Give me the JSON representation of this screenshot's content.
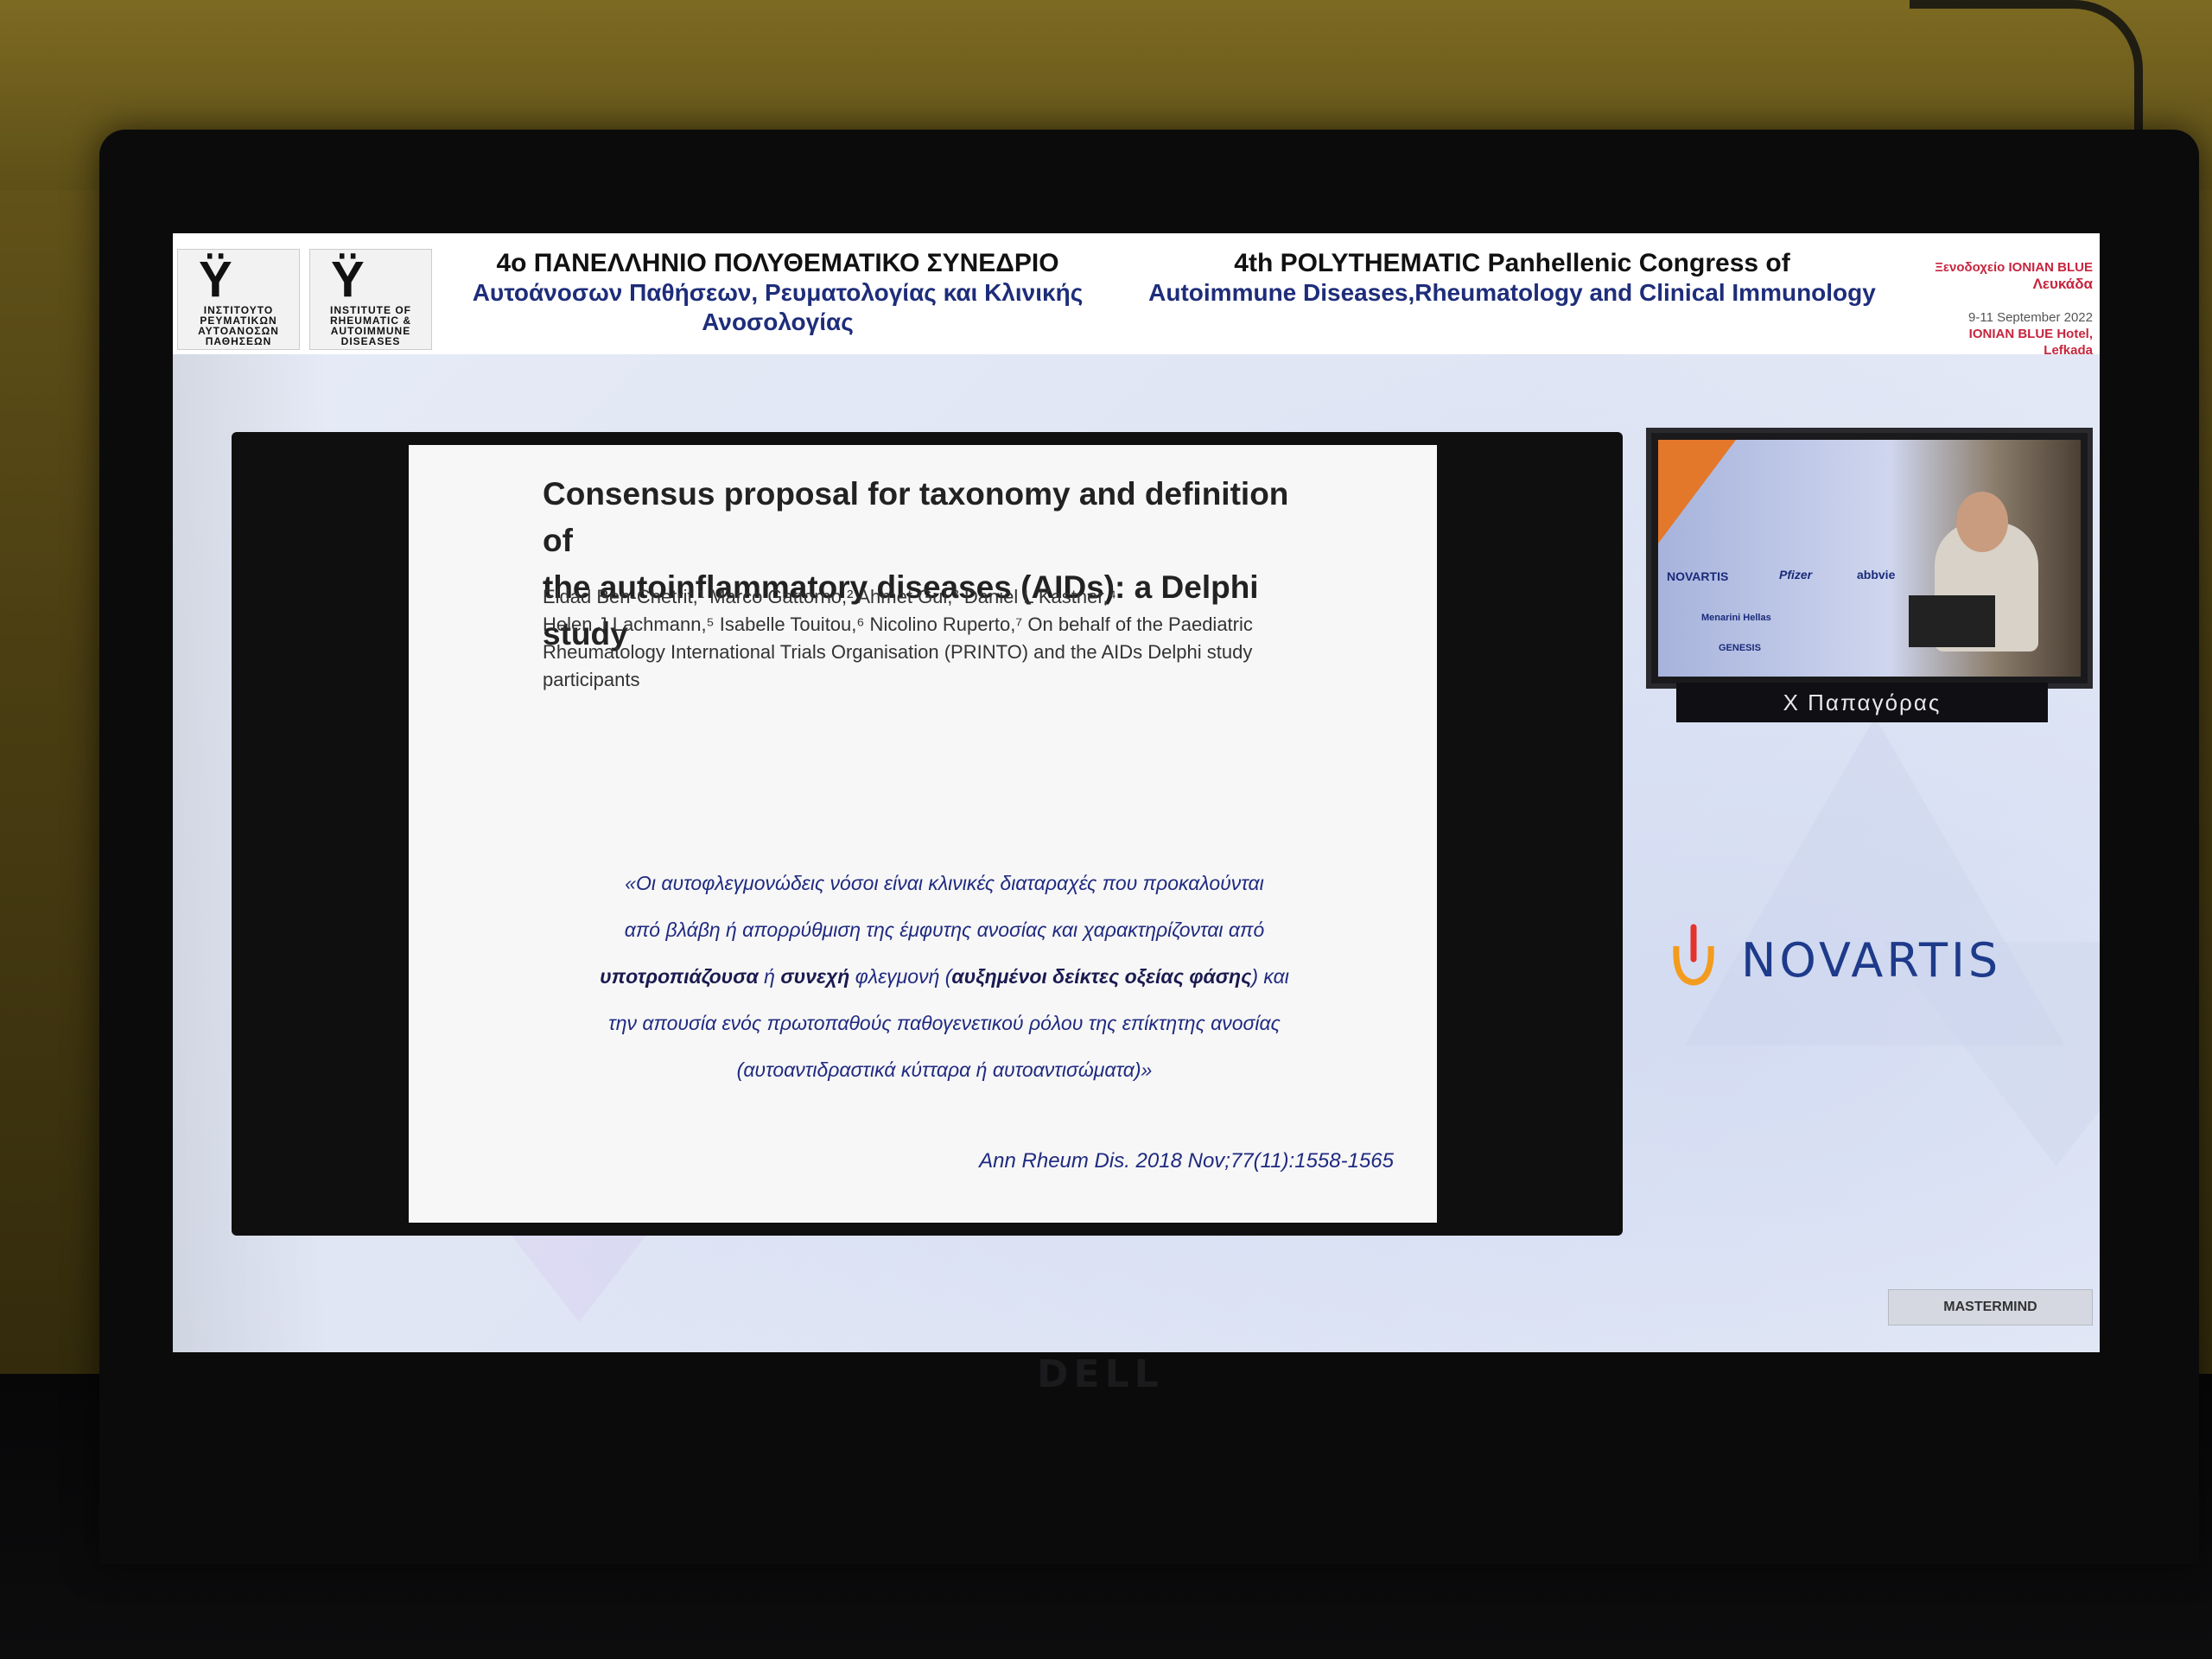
{
  "header": {
    "logo_gr_text": "ΙΝΣΤΙΤΟΥΤΟ ΡΕΥΜΑΤΙΚΩΝ ΑΥΤΟΑΝΟΣΩΝ ΠΑΘΗΣΕΩΝ",
    "logo_en_text": "INSTITUTE OF RHEUMATIC & AUTOIMMUNE DISEASES",
    "title_gr_line1": "4ο ΠΑΝΕΛΛΗΝΙΟ ΠΟΛΥΘΕΜΑΤΙΚΟ ΣΥΝΕΔΡΙΟ",
    "title_gr_line2": "Αυτοάνοσων Παθήσεων, Ρευματολογίας και Κλινικής Ανοσολογίας",
    "title_en_line1": "4th POLYTHEMATIC Panhellenic Congress of",
    "title_en_line2": "Autoimmune Diseases,Rheumatology and Clinical Immunology",
    "event_venue": "Ξενοδοχείο IONIAN BLUE",
    "event_city": "Λευκάδα",
    "event_dates": "9-11 September 2022",
    "event_hotel": "IONIAN BLUE Hotel,",
    "event_place": "Lefkada"
  },
  "slide": {
    "title_line1": "Consensus proposal for taxonomy and definition of",
    "title_line2": "the autoinflammatory diseases (AIDs): a Delphi study",
    "authors_line1": "Eldad Ben-Chetrit,¹ Marco Gattorno,² Ahmet Gul,³ Daniel L Kastner,⁴",
    "authors_line2": "Helen J Lachmann,⁵ Isabelle Touitou,⁶ Nicolino Ruperto,⁷ On behalf of the Paediatric",
    "authors_line3": "Rheumatology International Trials Organisation (PRINTO) and the AIDs Delphi study",
    "authors_line4": "participants",
    "quote_line1": "«Οι αυτοφλεγμονώδεις νόσοι είναι κλινικές διαταραχές που προκαλούνται",
    "quote_line2": "από βλάβη ή απορρύθμιση της έμφυτης ανοσίας και χαρακτηρίζονται από",
    "quote_line3_a": "υποτροπιάζουσα",
    "quote_line3_b": " ή ",
    "quote_line3_c": "συνεχή",
    "quote_line3_d": " φλεγμονή (",
    "quote_line3_e": "αυξημένοι δείκτες οξείας φάσης",
    "quote_line3_f": ") και",
    "quote_line4": "την απουσία ενός πρωτοπαθούς παθογενετικού ρόλου της επίκτητης ανοσίας",
    "quote_line5": "(αυτοαντιδραστικά κύτταρα ή αυτοαντισώματα)»",
    "citation": "Ann Rheum Dis. 2018 Nov;77(11):1558-1565"
  },
  "video": {
    "speaker_label": "Χ Παπαγόρας",
    "sponsors": [
      "NOVARTIS",
      "Pfizer",
      "abbvie",
      "Menarini Hellas",
      "GENESIS"
    ]
  },
  "sponsor_logo": {
    "name": "NOVARTIS",
    "color": "#1e3a8a"
  },
  "footer": {
    "brand": "MASTERMIND"
  },
  "monitor_brand": "DELL"
}
